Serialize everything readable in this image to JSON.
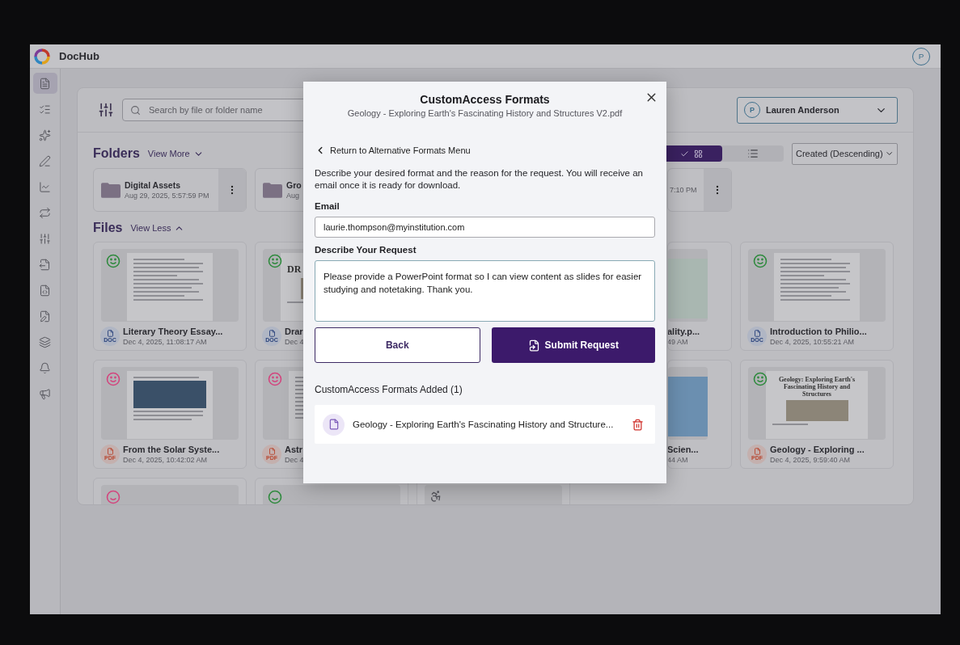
{
  "app": {
    "name": "DocHub",
    "avatar": "P"
  },
  "sidebar": {
    "items": [
      {
        "kind": "documents",
        "selected": true
      },
      {
        "kind": "tasks",
        "selected": false
      },
      {
        "kind": "favorites",
        "selected": false
      },
      {
        "kind": "sign",
        "selected": false
      },
      {
        "kind": "analytics",
        "selected": false
      },
      {
        "kind": "convert",
        "selected": false
      },
      {
        "kind": "adjust",
        "selected": false
      },
      {
        "kind": "export",
        "selected": false
      },
      {
        "kind": "template",
        "selected": false
      },
      {
        "kind": "share",
        "selected": false
      },
      {
        "kind": "layers",
        "selected": false
      },
      {
        "kind": "notifications",
        "selected": false
      },
      {
        "kind": "announcements",
        "selected": false
      }
    ]
  },
  "toolbar": {
    "search_placeholder": "Search by file or folder name",
    "user": {
      "avatar": "P",
      "name": "Lauren Anderson"
    }
  },
  "folders": {
    "heading": "Folders",
    "toggle": "View More",
    "view_modes": [
      {
        "kind": "grid",
        "selected": true
      },
      {
        "kind": "list",
        "selected": false
      }
    ],
    "sort": "Created (Descending)",
    "items": [
      {
        "kind": "full",
        "name": "Digital Assets",
        "date": "Aug 29, 2025, 5:57:59 PM"
      },
      {
        "kind": "cut-right",
        "name": "Gro",
        "date": "Aug"
      },
      {
        "kind": "cut-left",
        "date": "7:10 PM"
      }
    ]
  },
  "files": {
    "heading": "Files",
    "toggle": "View Less",
    "items": [
      {
        "kind": "full",
        "badge": {
          "kind": "doc",
          "label": "DOC"
        },
        "color": "#2f8a3e",
        "preview": {
          "kind": "text"
        },
        "name": "Literary Theory Essay...",
        "date": "Dec 4, 2025, 11:08:17 AM"
      },
      {
        "kind": "cut-right",
        "badge": {
          "kind": "doc",
          "label": "DOC"
        },
        "color": "#2f8a3e",
        "preview": {
          "kind": "heading",
          "title": "DR"
        },
        "name": "Drar",
        "date": "Dec 4"
      },
      {
        "kind": "cut-left",
        "preview": {
          "kind": "mint-image"
        },
        "name": "ality.p...",
        "date": "49 AM"
      },
      {
        "kind": "full",
        "badge": {
          "kind": "doc",
          "label": "DOC"
        },
        "color": "#2f8a3e",
        "preview": {
          "kind": "text"
        },
        "name": "Introduction to Philio...",
        "date": "Dec 4, 2025, 10:55:21 AM"
      },
      {
        "kind": "full",
        "badge": {
          "kind": "pdf",
          "label": "PDF"
        },
        "color": "#d2467e",
        "preview": {
          "kind": "photo"
        },
        "name": "From the Solar Syste...",
        "date": "Dec 4, 2025, 10:42:02 AM"
      },
      {
        "kind": "cut-right",
        "badge": {
          "kind": "pdf",
          "label": "PDF"
        },
        "color": "#d2467e",
        "preview": {
          "kind": "text"
        },
        "name": "Astr",
        "date": "Dec 4"
      },
      {
        "kind": "cut-left",
        "preview": {
          "kind": "sky-image"
        },
        "name": "Scien...",
        "date": "44 AM"
      },
      {
        "kind": "full",
        "badge": {
          "kind": "pdf",
          "label": "PDF"
        },
        "color": "#2f8a3e",
        "preview": {
          "kind": "heading",
          "title": "Geology: Exploring Earth's Fascinating History and Structures"
        },
        "name": "Geology - Exploring ...",
        "date": "Dec 4, 2025, 9:59:40 AM"
      },
      {
        "kind": "stub",
        "color": "#d2467e"
      },
      {
        "kind": "stub",
        "color": "#2f8a3e"
      },
      {
        "kind": "stub-pending"
      }
    ]
  },
  "modal": {
    "title": "CustomAccess Formats",
    "subtitle": "Geology - Exploring Earth's Fascinating History and Structures V2.pdf",
    "back_link": "Return to Alternative Formats Menu",
    "description": "Describe your desired format and the reason for the request. You will receive an email once it is ready for download.",
    "email_label": "Email",
    "email_value": "laurie.thompson@myinstitution.com",
    "request_label": "Describe Your Request",
    "request_value": "Please provide a PowerPoint format so I can view content as slides for easier studying and notetaking. Thank you.",
    "back_button": "Back",
    "submit_button": "Submit Request",
    "added_heading": "CustomAccess Formats Added (1)",
    "added_items": [
      {
        "name": "Geology - Exploring Earth's Fascinating History and Structure..."
      }
    ]
  }
}
